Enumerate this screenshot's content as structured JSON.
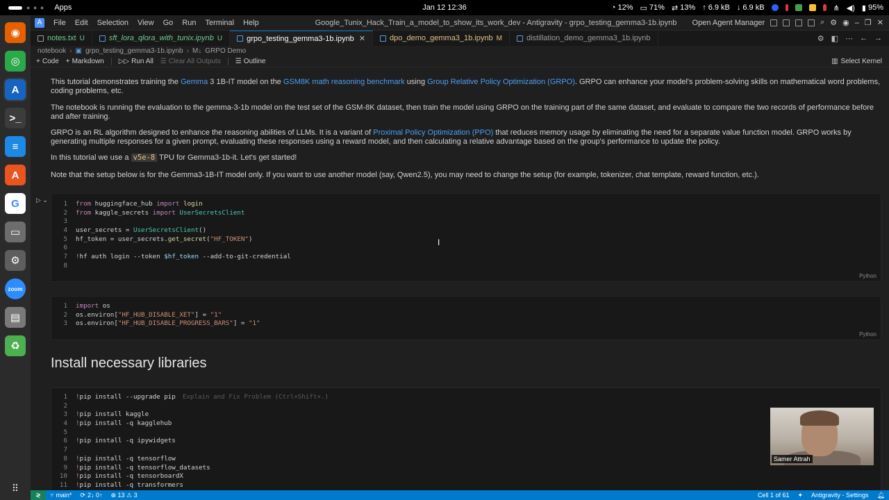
{
  "system_bar": {
    "apps_label": "Apps",
    "clock": "Jan 12  12:36",
    "stats": [
      {
        "icon": "cpu-icon",
        "value": "12%"
      },
      {
        "icon": "memory-icon",
        "value": "71%"
      },
      {
        "icon": "swap-icon",
        "value": "13%"
      },
      {
        "icon": "upload-icon",
        "value": "6.9 kB"
      },
      {
        "icon": "download-icon",
        "value": "6.9 kB"
      }
    ],
    "battery": "95%"
  },
  "dock": [
    {
      "name": "firefox-icon",
      "glyph": "◉",
      "color": "#e66000"
    },
    {
      "name": "chrome-icon",
      "glyph": "◎",
      "color": "#2aa84a"
    },
    {
      "name": "antigravity-icon",
      "glyph": "A",
      "color": "#1565c0"
    },
    {
      "name": "terminal-icon",
      "glyph": ">_",
      "color": "#3c3c3c"
    },
    {
      "name": "document-icon",
      "glyph": "≡",
      "color": "#1e88e5"
    },
    {
      "name": "app-store-icon",
      "glyph": "A",
      "color": "#e95420"
    },
    {
      "name": "google-icon",
      "glyph": "G",
      "color": "#ffffff"
    },
    {
      "name": "files-icon",
      "glyph": "▭",
      "color": "#6d6d6d"
    },
    {
      "name": "settings-icon",
      "glyph": "⚙",
      "color": "#5e5e5e"
    },
    {
      "name": "zoom-icon",
      "glyph": "zoom",
      "color": "#2d8cff"
    },
    {
      "name": "archive-icon",
      "glyph": "▤",
      "color": "#7a7a7a"
    },
    {
      "name": "trash-icon",
      "glyph": "♻",
      "color": "#4caf50"
    }
  ],
  "menu": [
    "File",
    "Edit",
    "Selection",
    "View",
    "Go",
    "Run",
    "Terminal",
    "Help"
  ],
  "window_title": "Google_Tunix_Hack_Train_a_model_to_show_its_work_dev - Antigravity - grpo_testing_gemma3-1b.ipynb",
  "agent_manager": "Open Agent Manager",
  "tabs": [
    {
      "label": "notes.txt",
      "mark": "U",
      "active": false,
      "color": "#73c991"
    },
    {
      "label": "sft_lora_qlora_with_tunix.ipynb",
      "mark": "U",
      "active": false,
      "color": "#73c991"
    },
    {
      "label": "grpo_testing_gemma3-1b.ipynb",
      "mark": "",
      "active": true,
      "color": "#ffffff"
    },
    {
      "label": "dpo_demo_gemma3_1b.ipynb",
      "mark": "M",
      "active": false,
      "color": "#e2c08d"
    },
    {
      "label": "distillation_demo_gemma3_1b.ipynb",
      "mark": "",
      "active": false,
      "color": "#9d9d9d"
    }
  ],
  "breadcrumb": [
    "notebook",
    "grpo_testing_gemma3-1b.ipynb",
    "GRPO Demo"
  ],
  "toolbar": {
    "code": "Code",
    "markdown": "Markdown",
    "run_all": "Run All",
    "clear_outputs": "Clear All Outputs",
    "outline": "Outline",
    "select_kernel": "Select Kernel"
  },
  "markdown": {
    "p1_a": "This tutorial demonstrates training the ",
    "p1_link1": "Gemma",
    "p1_b": " 3 1B-IT model on the ",
    "p1_link2": "GSM8K math reasoning benchmark",
    "p1_c": " using ",
    "p1_link3": "Group Relative Policy Optimization (GRPO)",
    "p1_d": ". GRPO can enhance your model's problem-solving skills on mathematical word problems, coding problems, etc.",
    "p2": "The notebook is running the evaluation to the gemma-3-1b model on the test set of the GSM-8K dataset, then train the model using GRPO on the training part of the same dataset, and evaluate to compare the two records of performance before and after training.",
    "p3_a": "GRPO is an RL algorithm designed to enhance the reasoning abilities of LLMs. It is a variant of ",
    "p3_link": "Proximal Policy Optimization (PPO)",
    "p3_b": " that reduces memory usage by eliminating the need for a separate value function model. GRPO works by generating multiple responses for a given prompt, evaluating these responses using a reward model, and then calculating a relative advantage based on the group's performance to update the policy.",
    "p4_a": "In this tutorial we use a ",
    "p4_code": "v5e-8",
    "p4_b": " TPU for Gemma3-1b-it. Let's get started!",
    "p5": "Note that the setup below is for the Gemma3-1B-IT model only. If you want to use another model (say, Qwen2.5), you may need to change the setup (for example, tokenizer, chat template, reward function, etc.).",
    "heading": "Install necessary libraries"
  },
  "cells": {
    "cell1": {
      "lang": "Python",
      "lines": [
        {
          "n": "1",
          "t": "from huggingface_hub import login"
        },
        {
          "n": "2",
          "t": "from kaggle_secrets import UserSecretsClient"
        },
        {
          "n": "3",
          "t": ""
        },
        {
          "n": "4",
          "t": "user_secrets = UserSecretsClient()"
        },
        {
          "n": "5",
          "t": "hf_token = user_secrets.get_secret(\"HF_TOKEN\")"
        },
        {
          "n": "6",
          "t": ""
        },
        {
          "n": "7",
          "t": "!hf auth login --token $hf_token --add-to-git-credential"
        },
        {
          "n": "8",
          "t": ""
        }
      ]
    },
    "cell2": {
      "lang": "Python",
      "lines": [
        {
          "n": "1",
          "t": "import os"
        },
        {
          "n": "2",
          "t": "os.environ[\"HF_HUB_DISABLE_XET\"] = \"1\""
        },
        {
          "n": "3",
          "t": "os.environ[\"HF_HUB_DISABLE_PROGRESS_BARS\"] = \"1\""
        }
      ]
    },
    "cell3": {
      "lines": [
        {
          "n": "1",
          "t": "!pip install --upgrade pip",
          "hint": "Explain and Fix Problem (Ctrl+Shift+.)"
        },
        {
          "n": "2",
          "t": ""
        },
        {
          "n": "3",
          "t": "!pip install kaggle"
        },
        {
          "n": "4",
          "t": "!pip install -q kagglehub"
        },
        {
          "n": "5",
          "t": ""
        },
        {
          "n": "6",
          "t": "!pip install -q ipywidgets"
        },
        {
          "n": "7",
          "t": ""
        },
        {
          "n": "8",
          "t": "!pip install -q tensorflow"
        },
        {
          "n": "9",
          "t": "!pip install -q tensorflow_datasets"
        },
        {
          "n": "10",
          "t": "!pip install -q tensorboardX"
        },
        {
          "n": "11",
          "t": "!pip install -q transformers"
        }
      ]
    }
  },
  "webcam": {
    "name": "Samer Attrah"
  },
  "statusbar": {
    "branch": "main*",
    "sync": "2↓ 0↑",
    "problems": "⊗ 13 ⚠ 3",
    "cell_pos": "Cell 1 of 61",
    "settings": "Antigravity - Settings"
  }
}
